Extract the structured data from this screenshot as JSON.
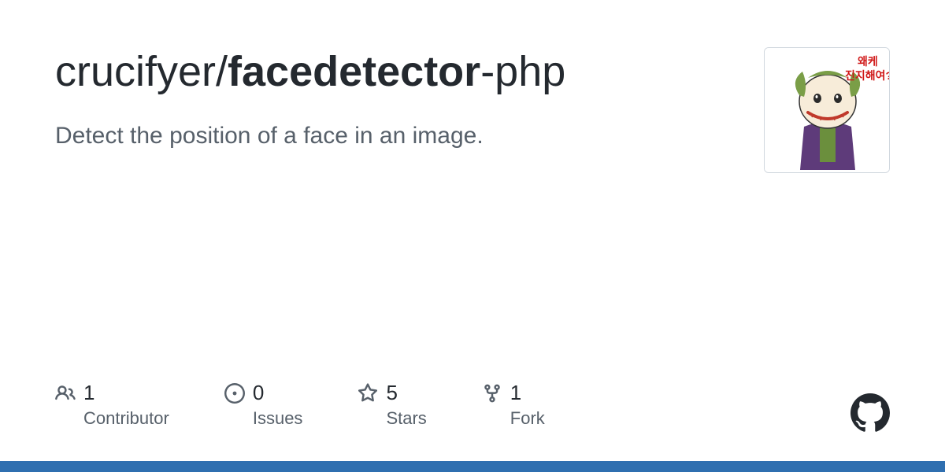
{
  "repo": {
    "owner": "crucifyer",
    "separator": "/",
    "name_bold": "facedetector",
    "name_tail": "-php"
  },
  "description": "Detect the position of a face in an image.",
  "stats": {
    "contributors": {
      "value": "1",
      "label": "Contributor"
    },
    "issues": {
      "value": "0",
      "label": "Issues"
    },
    "stars": {
      "value": "5",
      "label": "Stars"
    },
    "forks": {
      "value": "1",
      "label": "Fork"
    }
  }
}
